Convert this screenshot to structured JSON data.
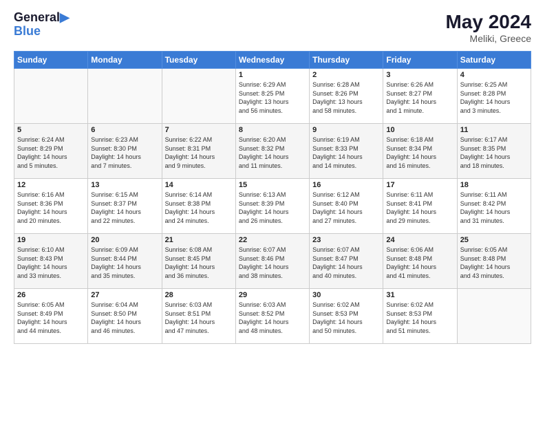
{
  "header": {
    "logo_line1": "General",
    "logo_line2": "Blue",
    "month_year": "May 2024",
    "location": "Meliki, Greece"
  },
  "weekdays": [
    "Sunday",
    "Monday",
    "Tuesday",
    "Wednesday",
    "Thursday",
    "Friday",
    "Saturday"
  ],
  "weeks": [
    [
      {
        "day": "",
        "info": ""
      },
      {
        "day": "",
        "info": ""
      },
      {
        "day": "",
        "info": ""
      },
      {
        "day": "1",
        "info": "Sunrise: 6:29 AM\nSunset: 8:25 PM\nDaylight: 13 hours\nand 56 minutes."
      },
      {
        "day": "2",
        "info": "Sunrise: 6:28 AM\nSunset: 8:26 PM\nDaylight: 13 hours\nand 58 minutes."
      },
      {
        "day": "3",
        "info": "Sunrise: 6:26 AM\nSunset: 8:27 PM\nDaylight: 14 hours\nand 1 minute."
      },
      {
        "day": "4",
        "info": "Sunrise: 6:25 AM\nSunset: 8:28 PM\nDaylight: 14 hours\nand 3 minutes."
      }
    ],
    [
      {
        "day": "5",
        "info": "Sunrise: 6:24 AM\nSunset: 8:29 PM\nDaylight: 14 hours\nand 5 minutes."
      },
      {
        "day": "6",
        "info": "Sunrise: 6:23 AM\nSunset: 8:30 PM\nDaylight: 14 hours\nand 7 minutes."
      },
      {
        "day": "7",
        "info": "Sunrise: 6:22 AM\nSunset: 8:31 PM\nDaylight: 14 hours\nand 9 minutes."
      },
      {
        "day": "8",
        "info": "Sunrise: 6:20 AM\nSunset: 8:32 PM\nDaylight: 14 hours\nand 11 minutes."
      },
      {
        "day": "9",
        "info": "Sunrise: 6:19 AM\nSunset: 8:33 PM\nDaylight: 14 hours\nand 14 minutes."
      },
      {
        "day": "10",
        "info": "Sunrise: 6:18 AM\nSunset: 8:34 PM\nDaylight: 14 hours\nand 16 minutes."
      },
      {
        "day": "11",
        "info": "Sunrise: 6:17 AM\nSunset: 8:35 PM\nDaylight: 14 hours\nand 18 minutes."
      }
    ],
    [
      {
        "day": "12",
        "info": "Sunrise: 6:16 AM\nSunset: 8:36 PM\nDaylight: 14 hours\nand 20 minutes."
      },
      {
        "day": "13",
        "info": "Sunrise: 6:15 AM\nSunset: 8:37 PM\nDaylight: 14 hours\nand 22 minutes."
      },
      {
        "day": "14",
        "info": "Sunrise: 6:14 AM\nSunset: 8:38 PM\nDaylight: 14 hours\nand 24 minutes."
      },
      {
        "day": "15",
        "info": "Sunrise: 6:13 AM\nSunset: 8:39 PM\nDaylight: 14 hours\nand 26 minutes."
      },
      {
        "day": "16",
        "info": "Sunrise: 6:12 AM\nSunset: 8:40 PM\nDaylight: 14 hours\nand 27 minutes."
      },
      {
        "day": "17",
        "info": "Sunrise: 6:11 AM\nSunset: 8:41 PM\nDaylight: 14 hours\nand 29 minutes."
      },
      {
        "day": "18",
        "info": "Sunrise: 6:11 AM\nSunset: 8:42 PM\nDaylight: 14 hours\nand 31 minutes."
      }
    ],
    [
      {
        "day": "19",
        "info": "Sunrise: 6:10 AM\nSunset: 8:43 PM\nDaylight: 14 hours\nand 33 minutes."
      },
      {
        "day": "20",
        "info": "Sunrise: 6:09 AM\nSunset: 8:44 PM\nDaylight: 14 hours\nand 35 minutes."
      },
      {
        "day": "21",
        "info": "Sunrise: 6:08 AM\nSunset: 8:45 PM\nDaylight: 14 hours\nand 36 minutes."
      },
      {
        "day": "22",
        "info": "Sunrise: 6:07 AM\nSunset: 8:46 PM\nDaylight: 14 hours\nand 38 minutes."
      },
      {
        "day": "23",
        "info": "Sunrise: 6:07 AM\nSunset: 8:47 PM\nDaylight: 14 hours\nand 40 minutes."
      },
      {
        "day": "24",
        "info": "Sunrise: 6:06 AM\nSunset: 8:48 PM\nDaylight: 14 hours\nand 41 minutes."
      },
      {
        "day": "25",
        "info": "Sunrise: 6:05 AM\nSunset: 8:48 PM\nDaylight: 14 hours\nand 43 minutes."
      }
    ],
    [
      {
        "day": "26",
        "info": "Sunrise: 6:05 AM\nSunset: 8:49 PM\nDaylight: 14 hours\nand 44 minutes."
      },
      {
        "day": "27",
        "info": "Sunrise: 6:04 AM\nSunset: 8:50 PM\nDaylight: 14 hours\nand 46 minutes."
      },
      {
        "day": "28",
        "info": "Sunrise: 6:03 AM\nSunset: 8:51 PM\nDaylight: 14 hours\nand 47 minutes."
      },
      {
        "day": "29",
        "info": "Sunrise: 6:03 AM\nSunset: 8:52 PM\nDaylight: 14 hours\nand 48 minutes."
      },
      {
        "day": "30",
        "info": "Sunrise: 6:02 AM\nSunset: 8:53 PM\nDaylight: 14 hours\nand 50 minutes."
      },
      {
        "day": "31",
        "info": "Sunrise: 6:02 AM\nSunset: 8:53 PM\nDaylight: 14 hours\nand 51 minutes."
      },
      {
        "day": "",
        "info": ""
      }
    ]
  ]
}
